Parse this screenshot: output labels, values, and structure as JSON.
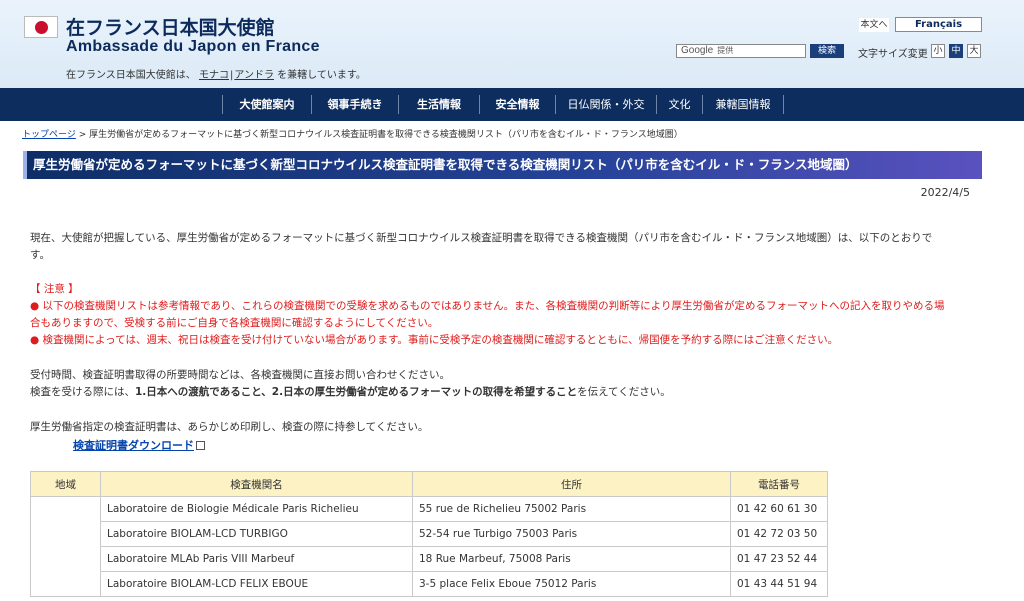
{
  "header": {
    "title_jp": "在フランス日本国大使館",
    "title_fr": "Ambassade du Japon en France",
    "sub_note_pre": "在フランス日本国大使館は、",
    "sub_link1": "モナコ",
    "sub_sep": "|",
    "sub_link2": "アンドラ",
    "sub_note_post": "を兼轄しています。",
    "lang_jp": "本文へ",
    "lang_fr": "Français",
    "search_google": "Google",
    "search_placeholder": "提供",
    "search_button": "検索",
    "fontsize_label": "文字サイズ変更",
    "fs_small": "小",
    "fs_mid": "中",
    "fs_large": "大"
  },
  "nav": [
    "大使館案内",
    "領事手続き",
    "生活情報",
    "安全情報",
    "日仏関係・外交",
    "文化",
    "兼轄国情報"
  ],
  "breadcrumb": {
    "home": "トップページ",
    "rest": " > 厚生労働省が定めるフォーマットに基づく新型コロナウイルス検査証明書を取得できる検査機関リスト（パリ市を含むイル・ド・フランス地域圏）"
  },
  "page_title": "厚生労働省が定めるフォーマットに基づく新型コロナウイルス検査証明書を取得できる検査機関リスト（パリ市を含むイル・ド・フランス地域圏）",
  "date": "2022/4/5",
  "intro_line1": "現在、大使館が把握している、厚生労働省が定めるフォーマットに基づく新型コロナウイルス検査証明書を取得できる検査機関（パリ市を含むイル・ド・フランス地域圏）は、以下のとおりで",
  "intro_line2": "す。",
  "notice": {
    "heading": "【 注意 】",
    "item1_line1": "● 以下の検査機関リストは参考情報であり、これらの検査機関での受験を求めるものではありません。また、各検査機関の判断等により厚生労働省が定めるフォーマットへの記入を取りやめる場",
    "item1_line2": "合もありますので、受検する前にご自身で各検査機関に確認するようにしてください。",
    "item2": "● 検査機関によっては、週末、祝日は検査を受け付けていない場合があります。事前に受検予定の検査機関に確認するとともに、帰国便を予約する際にはご注意ください。"
  },
  "contact_line1": "受付時間、検査証明書取得の所要時間などは、各検査機関に直接お問い合わせください。",
  "contact_line2_pre": "検査を受ける際には、",
  "contact_line2_bold": "1.日本への渡航であること、2.日本の厚生労働省が定めるフォーマットの取得を希望すること",
  "contact_line2_post": "を伝えてください。",
  "print_note": "厚生労働省指定の検査証明書は、あらかじめ印刷し、検査の際に持参してください。",
  "download_link": "検査証明書ダウンロード",
  "table": {
    "headers": [
      "地域",
      "検査機関名",
      "住所",
      "電話番号"
    ],
    "rows": [
      {
        "name": "Laboratoire de Biologie Médicale Paris Richelieu",
        "address": "55 rue de Richelieu 75002 Paris",
        "phone": "01 42 60 61 30"
      },
      {
        "name": "Laboratoire BIOLAM-LCD TURBIGO",
        "address": "52-54 rue Turbigo 75003 Paris",
        "phone": "01 42 72 03 50"
      },
      {
        "name": "Laboratoire MLAb Paris VIII Marbeuf",
        "address": "18 Rue Marbeuf, 75008 Paris",
        "phone": "01 47 23 52 44"
      },
      {
        "name": "Laboratoire BIOLAM-LCD FELIX EBOUE",
        "address": "3-5 place Felix Eboue 75012 Paris",
        "phone": "01 43 44 51 94"
      }
    ]
  },
  "colors": {
    "nav_bg": "#0d2d5e",
    "title_bar_start": "#0e2e67",
    "title_bar_end": "#5a52bf",
    "notice_red": "#e01b1b",
    "table_header_bg": "#fdf2c4",
    "link_blue": "#0645ad"
  }
}
